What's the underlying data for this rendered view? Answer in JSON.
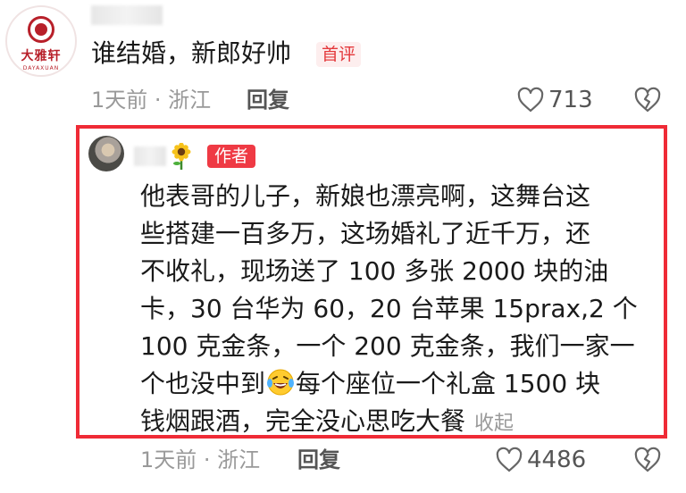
{
  "comment": {
    "text": "谁结婚，新郎好帅",
    "badge": "首评",
    "time_location": "1天前 · 浙江",
    "reply_label": "回复",
    "like_count": "713",
    "avatar_logo": {
      "name_cn": "大雅轩",
      "name_en": "DAYAXUAN"
    }
  },
  "reply": {
    "badge": "作者",
    "lines": [
      "他表哥的儿子，新娘也漂亮啊，这舞台这",
      "些搭建一百多万，这场婚礼了近千万，还",
      "不收礼，现场送了 100 多张 2000 块的油",
      "卡，30 台华为 60，20 台苹果 15prax,2 个",
      "100 克金条，一个 200 克金条，我们一家一"
    ],
    "line6_before": "个也没中到",
    "line6_after": "每个座位一个礼盒 1500 块",
    "line7": "钱烟跟酒，完全没心思吃大餐",
    "collapse_label": "收起",
    "time_location": "1天前 · 浙江",
    "reply_label": "回复",
    "like_count": "4486"
  },
  "icons": {
    "like": "heart-outline-icon",
    "dislike": "broken-heart-icon",
    "emoji": "laughing-tears-emoji-icon",
    "decoration": "sunflower-icon"
  },
  "colors": {
    "highlight_border": "#ef2b36",
    "author_badge": "#ef3a44",
    "first_badge_text": "#e4393c",
    "meta_text": "#999999"
  }
}
